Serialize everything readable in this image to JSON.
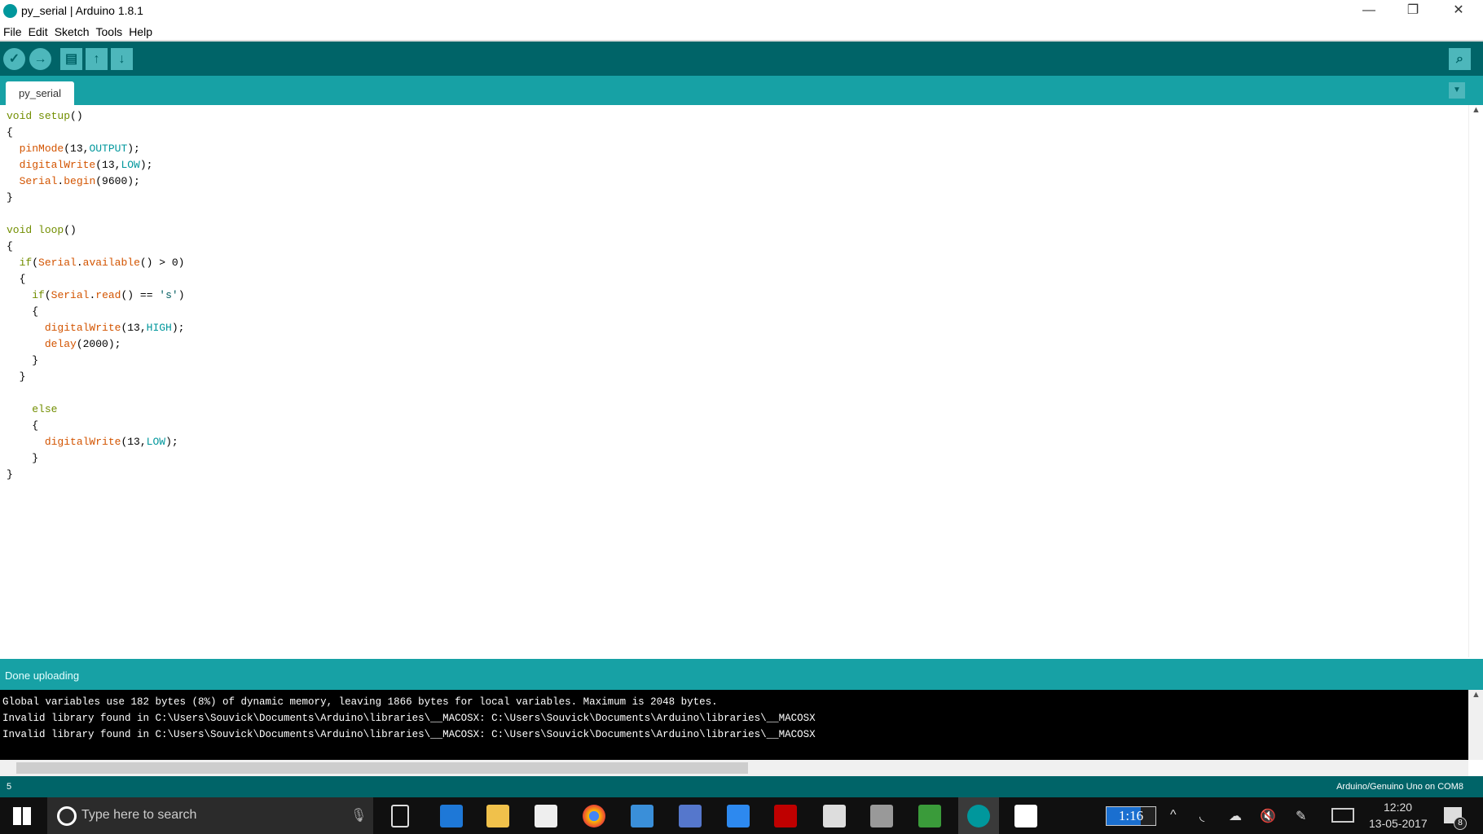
{
  "window": {
    "title": "py_serial | Arduino 1.8.1",
    "minimize": "—",
    "restore": "❐",
    "close": "✕"
  },
  "menu": [
    "File",
    "Edit",
    "Sketch",
    "Tools",
    "Help"
  ],
  "toolbar": {
    "verify": "✓",
    "upload": "→",
    "new": "▤",
    "open": "↑",
    "save": "↓",
    "serial_monitor": "⌕"
  },
  "tab": {
    "label": "py_serial",
    "menu_arrow": "▼"
  },
  "status": {
    "message": "Done uploading",
    "line_number": "5",
    "board": "Arduino/Genuino Uno on COM8"
  },
  "console": [
    "Global variables use 182 bytes (8%) of dynamic memory, leaving 1866 bytes for local variables. Maximum is 2048 bytes.",
    "Invalid library found in C:\\Users\\Souvick\\Documents\\Arduino\\libraries\\__MACOSX: C:\\Users\\Souvick\\Documents\\Arduino\\libraries\\__MACOSX",
    "Invalid library found in C:\\Users\\Souvick\\Documents\\Arduino\\libraries\\__MACOSX: C:\\Users\\Souvick\\Documents\\Arduino\\libraries\\__MACOSX"
  ],
  "taskbar": {
    "search_placeholder": "Type here to search",
    "battery": "1:16",
    "time": "12:20",
    "date": "13-05-2017",
    "notifications": "8"
  }
}
